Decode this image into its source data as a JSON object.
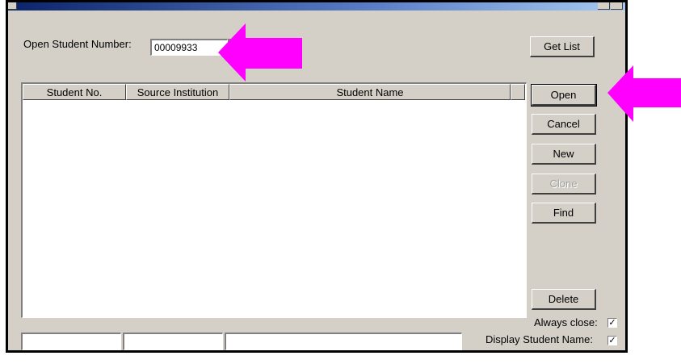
{
  "open_student": {
    "label": "Open Student Number:",
    "value": "00009933"
  },
  "buttons": {
    "get_list": "Get List",
    "open": "Open",
    "cancel": "Cancel",
    "new": "New",
    "clone": "Clone",
    "find": "Find",
    "delete": "Delete"
  },
  "table": {
    "columns": [
      "Student No.",
      "Source Institution",
      "Student Name"
    ],
    "rows": []
  },
  "options": {
    "always_close": {
      "label": "Always close:",
      "checked": true
    },
    "display_student_name": {
      "label": "Display Student Name:",
      "checked": true
    }
  },
  "colors": {
    "dialog_bg": "#d4d0c8",
    "annotation_arrow": "#ff00ff"
  },
  "icons": {
    "check": "✓"
  }
}
